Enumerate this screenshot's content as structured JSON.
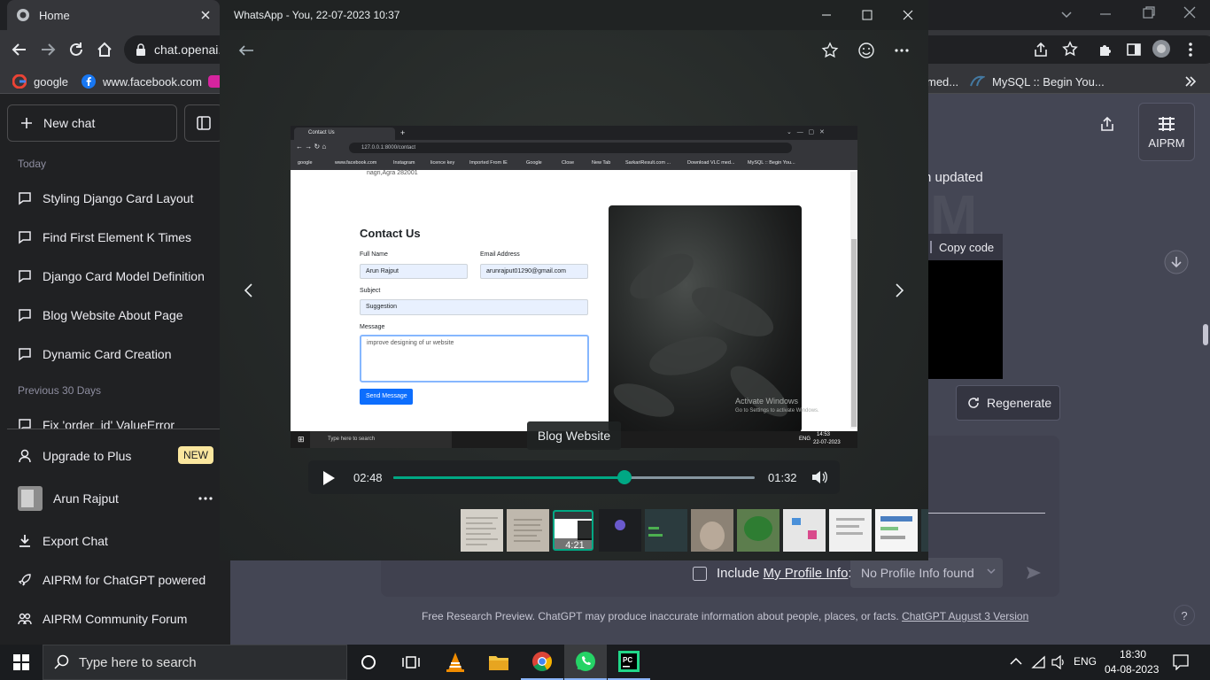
{
  "browser": {
    "tab_title": "Home",
    "url": "chat.openai.",
    "bookmarks": [
      "google",
      "www.facebook.com",
      "med...",
      "MySQL :: Begin You..."
    ]
  },
  "sidebar": {
    "new_chat": "New chat",
    "today_label": "Today",
    "today_items": [
      "Styling Django Card Layout",
      "Find First Element K Times",
      "Django Card Model Definition",
      "Blog Website About Page",
      "Dynamic Card Creation"
    ],
    "prev_label": "Previous 30 Days",
    "prev_items": [
      "Fix 'order_id' ValueError"
    ],
    "upgrade": "Upgrade to Plus",
    "new_badge": "NEW",
    "user_name": "Arun Rajput",
    "export": "Export Chat",
    "aiprm_powered": "AIPRM for ChatGPT powered",
    "aiprm_forum": "AIPRM Community Forum"
  },
  "chat": {
    "aiprm_label": "AIPRM",
    "updated_text": "n updated",
    "copy_code": "Copy code",
    "regenerate": "Regenerate",
    "include_label": "Include ",
    "profile_link": "My Profile Info",
    "colon": ":",
    "profile_select": "No Profile Info found",
    "footer_text": "Free Research Preview. ChatGPT may produce inaccurate information about people, places, or facts. ",
    "footer_link": "ChatGPT August 3 Version",
    "help": "?"
  },
  "whatsapp": {
    "title": "WhatsApp - You, 22-07-2023 10:37",
    "caption": "Blog Website",
    "time_elapsed": "02:48",
    "time_remaining": "01:32",
    "progress": 0.64,
    "thumb_duration": "4:21"
  },
  "inner": {
    "tab_title": "Contact Us",
    "url": "127.0.0.1:8000/contact",
    "bookmarks": [
      "google",
      "www.facebook.com",
      "Instagram",
      "licence key",
      "Imported From IE",
      "Google",
      "Close",
      "New Tab",
      "SarkariResult.com ...",
      "Download VLC med...",
      "MySQL :: Begin You..."
    ],
    "address_tail": "nagri,Agra 282001",
    "heading": "Contact Us",
    "full_name_label": "Full Name",
    "full_name_value": "Arun Rajput",
    "email_label": "Email Address",
    "email_value": "arunrajput01290@gmail.com",
    "subject_label": "Subject",
    "subject_value": "Suggestion",
    "message_label": "Message",
    "message_value": "improve designing of ur website",
    "send_button": "Send Message",
    "activate_title": "Activate Windows",
    "activate_sub": "Go to Settings to activate Windows.",
    "search_placeholder": "Type here to search",
    "lang": "ENG",
    "time": "14:53",
    "date": "22-07-2023"
  },
  "taskbar": {
    "search_placeholder": "Type here to search",
    "lang": "ENG",
    "time": "18:30",
    "date": "04-08-2023"
  },
  "colors": {
    "whatsapp_green": "#00a884",
    "chatgpt_sidebar": "#202123",
    "chatgpt_main": "#444654"
  }
}
